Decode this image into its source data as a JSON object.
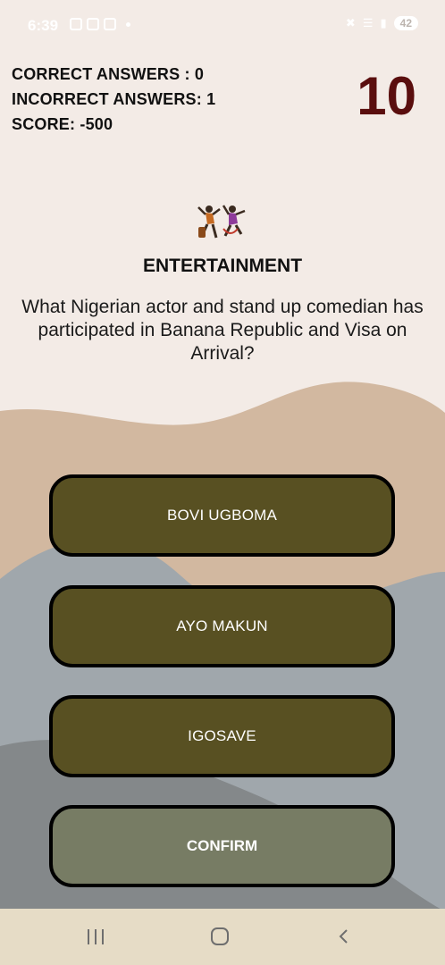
{
  "status_bar": {
    "time": "6:39",
    "battery": "42",
    "left_icons": [
      "screenshot-icon",
      "notification-badge-icon",
      "gallery-icon"
    ],
    "right_icons": [
      "mute-icon",
      "wifi-icon",
      "signal-icon"
    ]
  },
  "stats": {
    "correct": "CORRECT ANSWERS : 0",
    "incorrect": "INCORRECT ANSWERS: 1",
    "score": "SCORE: -500"
  },
  "timer": "10",
  "category": {
    "title": "ENTERTAINMENT",
    "icon": "dancers-icon"
  },
  "question": "What Nigerian actor and stand up comedian has participated in Banana Republic and Visa on Arrival?",
  "answers": [
    {
      "label": "BOVI UGBOMA"
    },
    {
      "label": "AYO MAKUN"
    },
    {
      "label": "IGOSAVE"
    }
  ],
  "confirm_label": "CONFIRM",
  "colors": {
    "background": "#f3ebe6",
    "tan_wave": "#d2b8a0",
    "grey_wave": "#a0a7ac",
    "dark_grey_wave": "#84888a",
    "answer_button": "#585022",
    "confirm_button": "#777c64",
    "timer": "#5a0e0e",
    "nav_bar": "#e6dcc6"
  },
  "nav_bar": {
    "items": [
      "recent-apps-icon",
      "home-icon",
      "back-icon"
    ]
  }
}
